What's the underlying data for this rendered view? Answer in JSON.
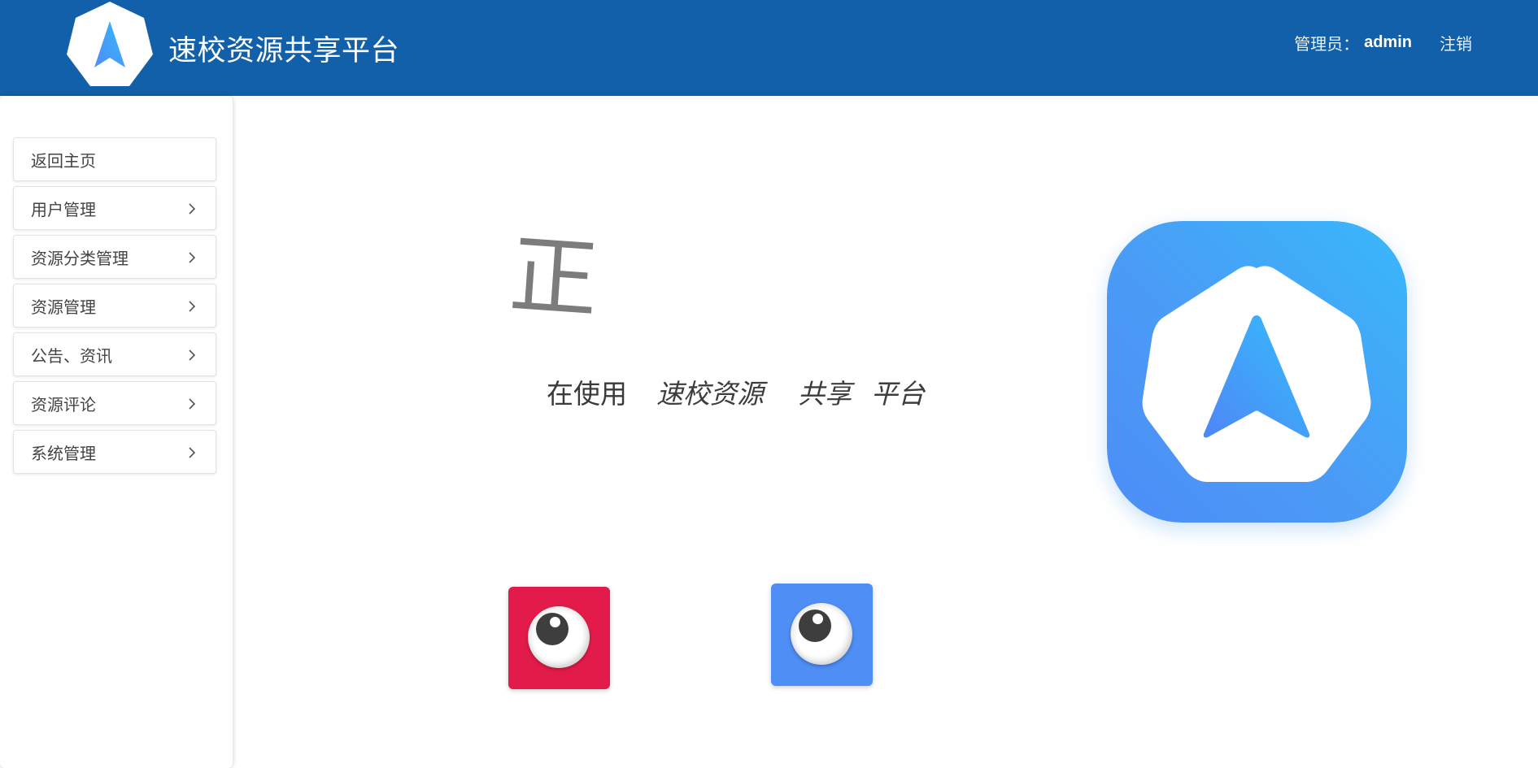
{
  "header": {
    "app_title": "速校资源共享平台",
    "admin_label": "管理员：",
    "admin_name": "admin",
    "logout_label": "注销",
    "background_color": "#1160a9"
  },
  "sidebar": {
    "items": [
      {
        "label": "返回主页",
        "has_chevron": false
      },
      {
        "label": "用户管理",
        "has_chevron": true
      },
      {
        "label": "资源分类管理",
        "has_chevron": true
      },
      {
        "label": "资源管理",
        "has_chevron": true
      },
      {
        "label": "公告、资讯",
        "has_chevron": true
      },
      {
        "label": "资源评论",
        "has_chevron": true
      },
      {
        "label": "系统管理",
        "has_chevron": true
      }
    ],
    "chevron_icon": "chevron-right-icon"
  },
  "main": {
    "big_glyph": "正",
    "welcome": {
      "prefix": "在使用",
      "word1": "速校资源",
      "word2": "共享",
      "word3": "平台"
    },
    "app_icon": {
      "icon": "navigation-arrow-icon",
      "gradient_start": "#4d8df7",
      "gradient_end": "#38b8fb"
    },
    "eye_cards": [
      {
        "icon": "eye-icon",
        "color": "#e31b4a"
      },
      {
        "icon": "eye-icon",
        "color": "#4f8ef5"
      }
    ]
  }
}
